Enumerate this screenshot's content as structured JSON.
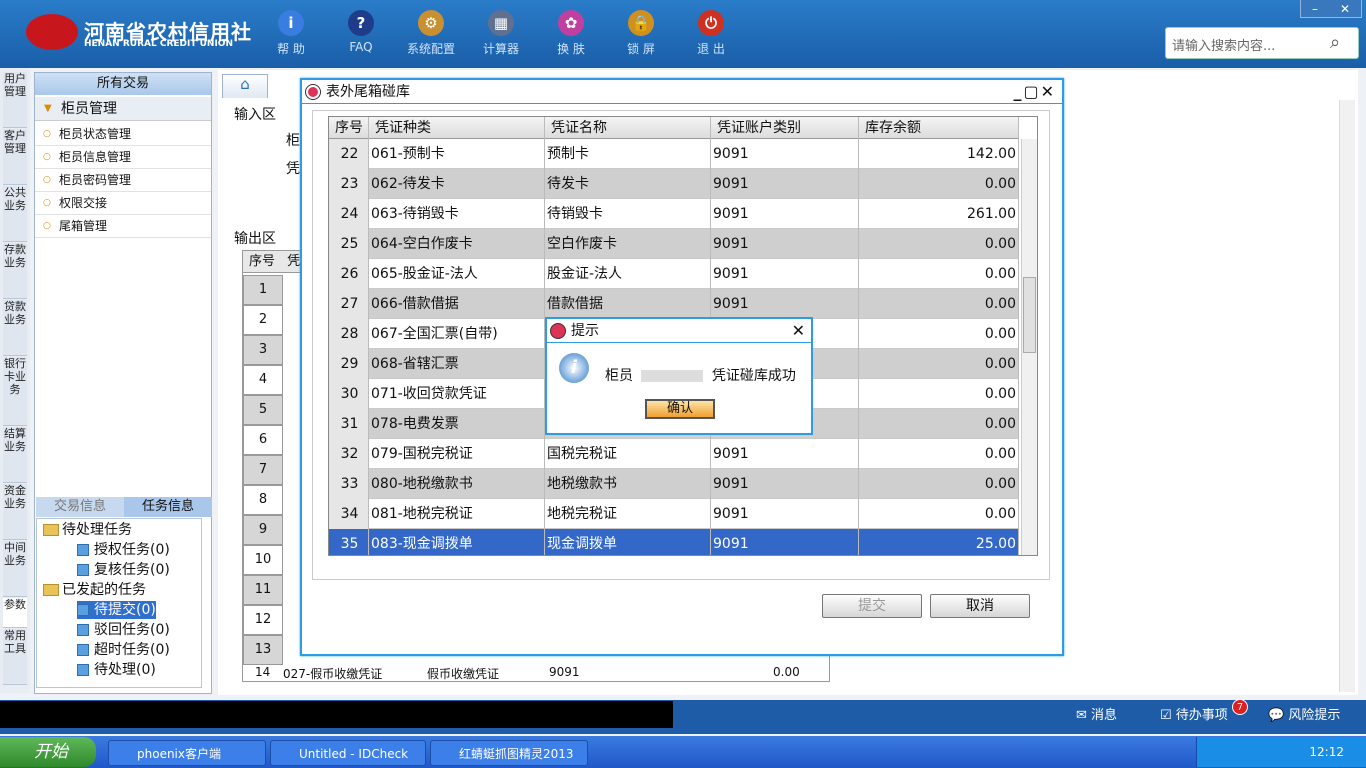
{
  "app": {
    "logo_cn": "河南省农村信用社",
    "logo_en": "HENAN RURAL CREDIT UNION"
  },
  "toolbar": [
    {
      "label": "帮 助",
      "icon": "help-icon",
      "glyph": "i",
      "color": "#3a7de0"
    },
    {
      "label": "FAQ",
      "icon": "faq-icon",
      "glyph": "?",
      "color": "#1e3c8a"
    },
    {
      "label": "系统配置",
      "icon": "config-icon",
      "glyph": "⚙",
      "color": "#c89030"
    },
    {
      "label": "计算器",
      "icon": "calculator-icon",
      "glyph": "▦",
      "color": "#607090"
    },
    {
      "label": "换 肤",
      "icon": "skin-icon",
      "glyph": "✿",
      "color": "#c040a0"
    },
    {
      "label": "锁 屏",
      "icon": "lock-icon",
      "glyph": "🔒",
      "color": "#d09020"
    },
    {
      "label": "退 出",
      "icon": "exit-icon",
      "glyph": "⏻",
      "color": "#d03020"
    }
  ],
  "window_controls": {
    "minimize": "–",
    "close": "✕"
  },
  "search": {
    "placeholder": "请输入搜索内容..."
  },
  "left_tabs": [
    "用户管理",
    "客户管理",
    "公共业务",
    "存款业务",
    "贷款业务",
    "银行卡业务",
    "结算业务",
    "资金业务",
    "中间业务",
    "参数",
    "常用工具"
  ],
  "sidebar": {
    "header": "所有交易",
    "group": "柜员管理",
    "items": [
      "柜员状态管理",
      "柜员信息管理",
      "柜员密码管理",
      "权限交接",
      "尾箱管理"
    ]
  },
  "task_tabs": [
    "交易信息",
    "任务信息"
  ],
  "tree": {
    "pending": "待处理任务",
    "auth": "授权任务(0)",
    "review": "复核任务(0)",
    "initiated": "已发起的任务",
    "to_submit": "待提交(0)",
    "rejected": "驳回任务(0)",
    "timeout": "超时任务(0)",
    "to_process": "待处理(0)"
  },
  "main": {
    "input_area": "输入区",
    "output_area": "输出区",
    "frag1": "柜",
    "frag2": "凭",
    "bg_header_no": "序号",
    "bg_header_frag": "凭",
    "bg_rows": [
      "1",
      "2",
      "3",
      "4",
      "5",
      "6",
      "7",
      "8",
      "9",
      "10",
      "11",
      "12",
      "13"
    ],
    "bg_last_row": {
      "no": "14",
      "type": "027-假币收缴凭证",
      "name": "假币收缴凭证",
      "acct": "9091",
      "amount": "0.00"
    }
  },
  "dialog": {
    "title": "表外尾箱碰库",
    "controls": "_▢✕",
    "columns": [
      "序号",
      "凭证种类",
      "凭证名称",
      "凭证账户类别",
      "库存余额"
    ],
    "rows": [
      {
        "no": "22",
        "type": "061-预制卡",
        "name": "预制卡",
        "acct": "9091",
        "amount": "142.00"
      },
      {
        "no": "23",
        "type": "062-待发卡",
        "name": "待发卡",
        "acct": "9091",
        "amount": "0.00"
      },
      {
        "no": "24",
        "type": "063-待销毁卡",
        "name": "待销毁卡",
        "acct": "9091",
        "amount": "261.00"
      },
      {
        "no": "25",
        "type": "064-空白作废卡",
        "name": "空白作废卡",
        "acct": "9091",
        "amount": "0.00"
      },
      {
        "no": "26",
        "type": "065-股金证-法人",
        "name": "股金证-法人",
        "acct": "9091",
        "amount": "0.00"
      },
      {
        "no": "27",
        "type": "066-借款借据",
        "name": "借款借据",
        "acct": "9091",
        "amount": "0.00"
      },
      {
        "no": "28",
        "type": "067-全国汇票(自带)",
        "name": "",
        "acct": "",
        "amount": "0.00"
      },
      {
        "no": "29",
        "type": "068-省辖汇票",
        "name": "",
        "acct": "",
        "amount": "0.00"
      },
      {
        "no": "30",
        "type": "071-收回贷款凭证",
        "name": "",
        "acct": "",
        "amount": "0.00"
      },
      {
        "no": "31",
        "type": "078-电费发票",
        "name": "",
        "acct": "",
        "amount": "0.00"
      },
      {
        "no": "32",
        "type": "079-国税完税证",
        "name": "国税完税证",
        "acct": "9091",
        "amount": "0.00"
      },
      {
        "no": "33",
        "type": "080-地税缴款书",
        "name": "地税缴款书",
        "acct": "9091",
        "amount": "0.00"
      },
      {
        "no": "34",
        "type": "081-地税完税证",
        "name": "地税完税证",
        "acct": "9091",
        "amount": "0.00"
      },
      {
        "no": "35",
        "type": "083-现金调拨单",
        "name": "现金调拨单",
        "acct": "9091",
        "amount": "25.00"
      }
    ],
    "submit": "提交",
    "cancel": "取消"
  },
  "alert": {
    "title": "提示",
    "msg_prefix": "柜员",
    "msg_suffix": "凭证碰库成功",
    "ok": "确认"
  },
  "status": {
    "messages": "消息",
    "todo": "待办事项",
    "todo_count": "7",
    "risk": "风险提示"
  },
  "taskbar": {
    "start": "开始",
    "tasks": [
      "phoenix客户端",
      "Untitled - IDCheck",
      "红蜻蜓抓图精灵2013"
    ],
    "time": "12:12"
  }
}
